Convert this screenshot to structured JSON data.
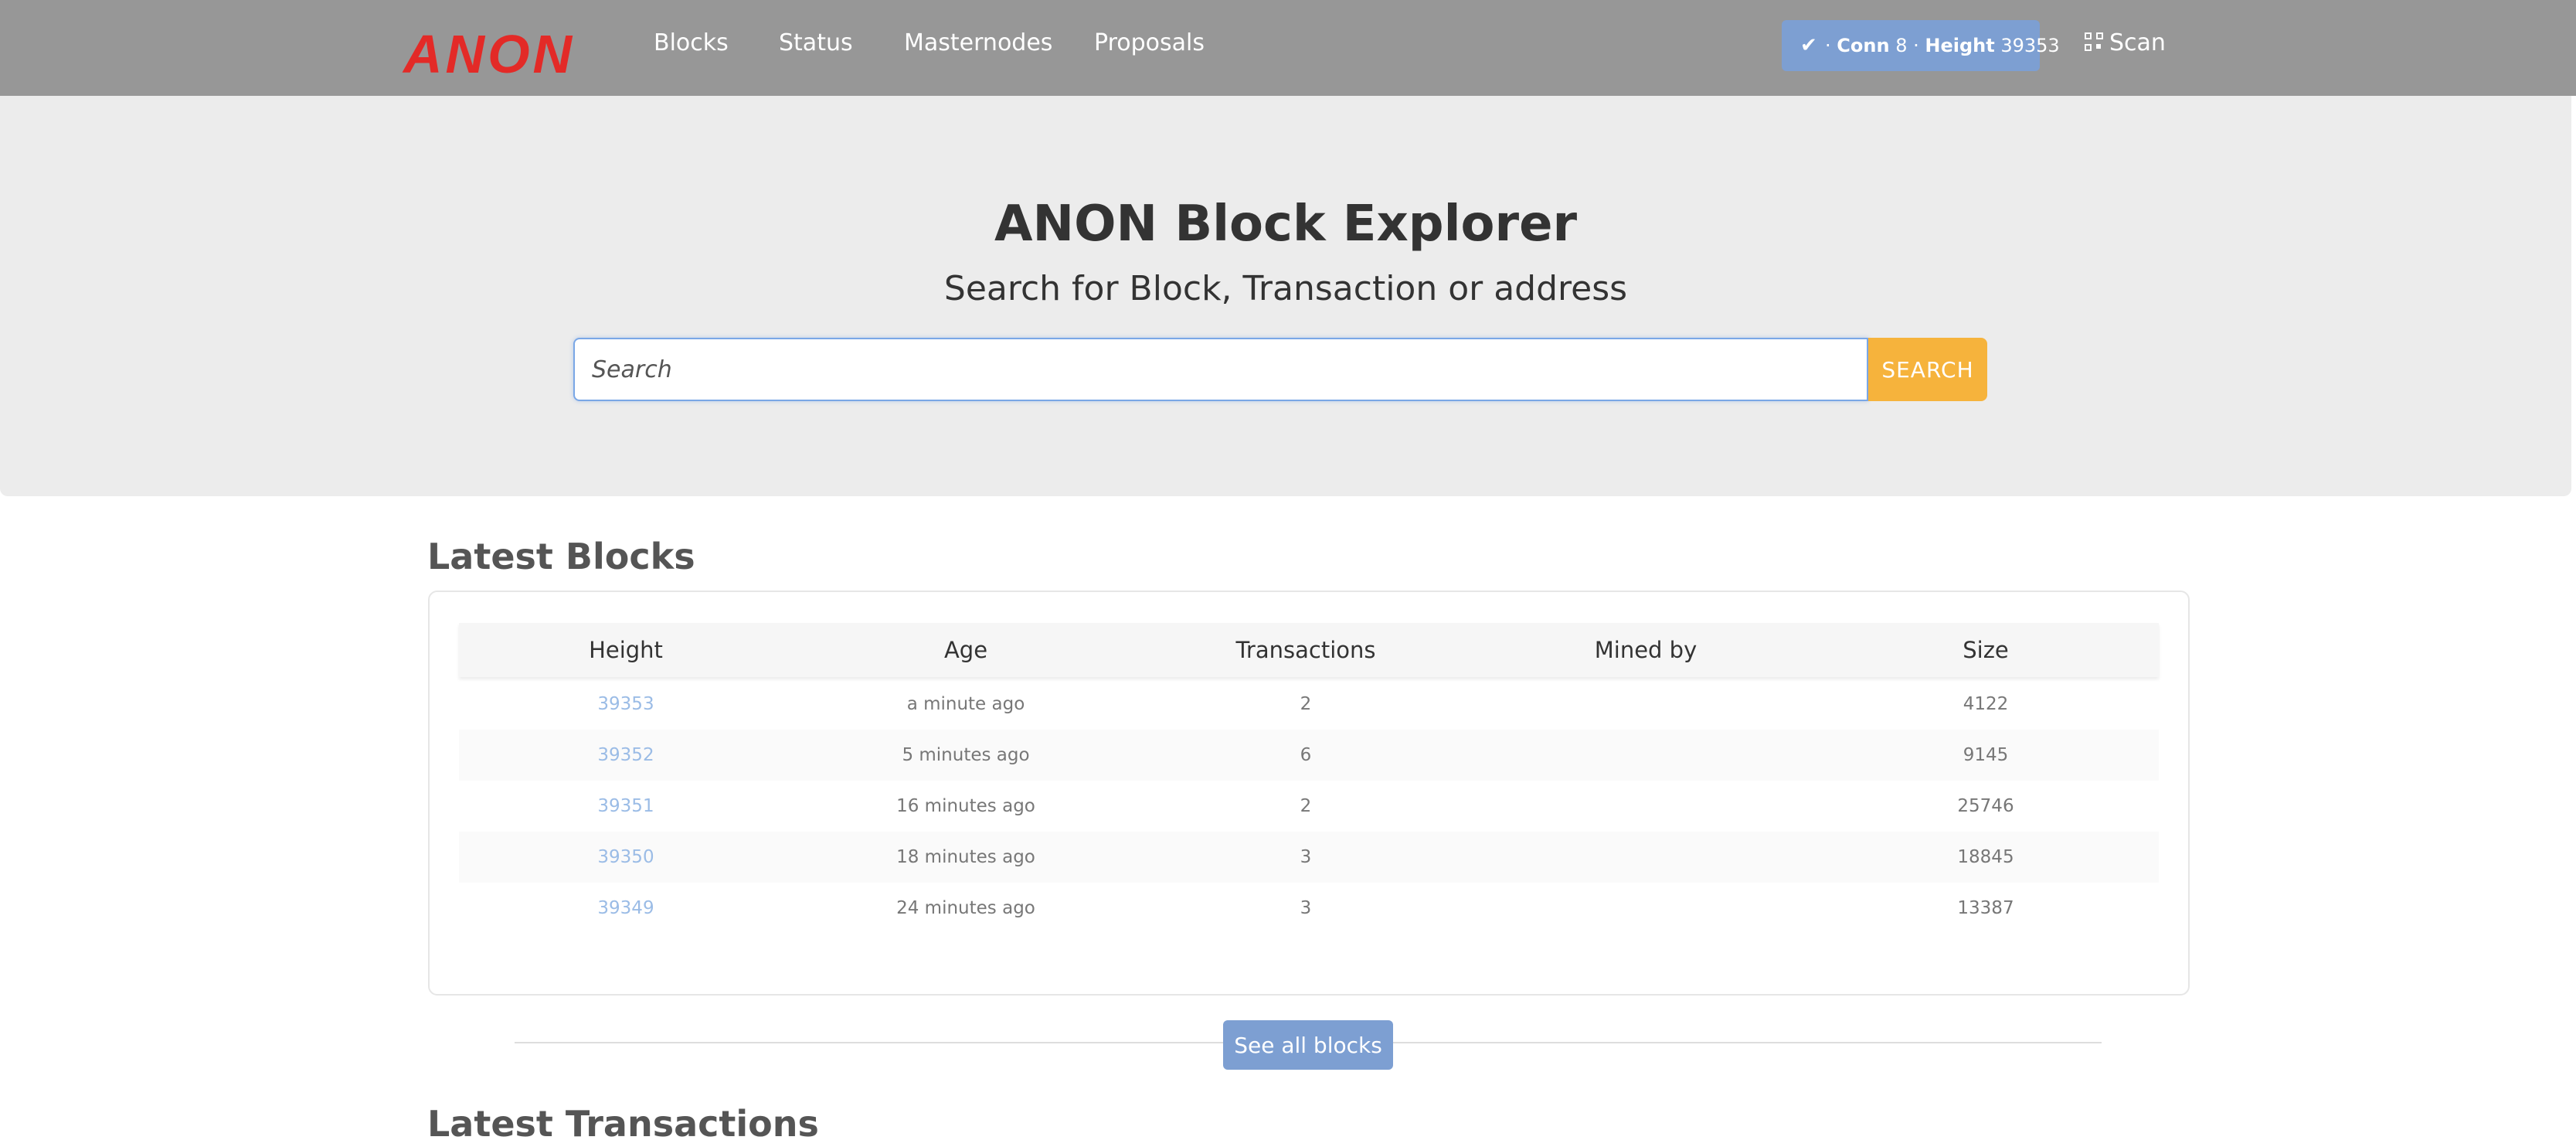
{
  "brand": {
    "logo_text": "ANON",
    "logo_color": "#e32a27"
  },
  "nav": {
    "links": [
      "Blocks",
      "Status",
      "Masternodes",
      "Proposals"
    ],
    "status": {
      "icon": "check-icon",
      "prefix": "· ",
      "conn_label": "Conn",
      "conn_value": "8",
      "sep": " · ",
      "height_label": "Height",
      "height_value": "39353"
    },
    "scan": {
      "icon": "qr-code-icon",
      "label": "Scan"
    }
  },
  "hero": {
    "title": "ANON Block Explorer",
    "subtitle": "Search for Block, Transaction or address",
    "search_placeholder": "Search",
    "search_button": "SEARCH"
  },
  "latest_blocks": {
    "title": "Latest Blocks",
    "columns": [
      "Height",
      "Age",
      "Transactions",
      "Mined by",
      "Size"
    ],
    "rows": [
      {
        "height": "39353",
        "age": "a minute ago",
        "transactions": "2",
        "mined_by": "",
        "size": "4122"
      },
      {
        "height": "39352",
        "age": "5 minutes ago",
        "transactions": "6",
        "mined_by": "",
        "size": "9145"
      },
      {
        "height": "39351",
        "age": "16 minutes ago",
        "transactions": "2",
        "mined_by": "",
        "size": "25746"
      },
      {
        "height": "39350",
        "age": "18 minutes ago",
        "transactions": "3",
        "mined_by": "",
        "size": "18845"
      },
      {
        "height": "39349",
        "age": "24 minutes ago",
        "transactions": "3",
        "mined_by": "",
        "size": "13387"
      }
    ],
    "see_all": "See all blocks"
  },
  "latest_transactions": {
    "title": "Latest Transactions"
  },
  "colors": {
    "navbar": "#979797",
    "accent_blue": "#7d9fd2",
    "search_button": "#f6b33c",
    "link": "#9bbce6"
  }
}
